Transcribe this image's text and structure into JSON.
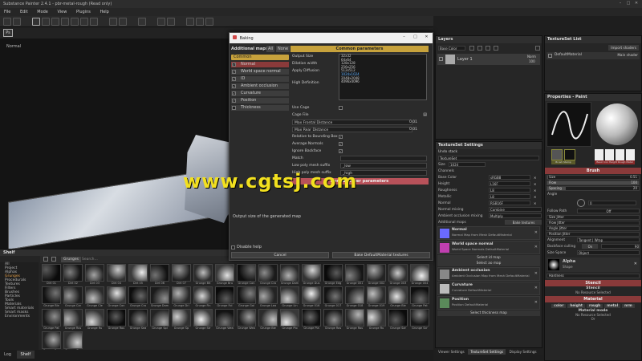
{
  "app": {
    "title": "Substance Painter 2.4.1 - pbr-metal-rough (Read only)"
  },
  "menu": [
    "File",
    "Edit",
    "Mode",
    "View",
    "Plugins",
    "Help"
  ],
  "viewport": {
    "label": "Normal"
  },
  "watermark": "www.cgtsj.com",
  "baking": {
    "title": "Baking",
    "additional_maps_label": "Additional maps",
    "all_label": "All",
    "none_label": "None",
    "common_label": "Common",
    "maps": [
      {
        "label": "Normal",
        "checked": true,
        "active": true
      },
      {
        "label": "World space normal",
        "checked": true
      },
      {
        "label": "ID",
        "checked": true
      },
      {
        "label": "Ambient occlusion",
        "checked": true
      },
      {
        "label": "Curvature",
        "checked": true
      },
      {
        "label": "Position",
        "checked": true
      },
      {
        "label": "Thickness",
        "checked": false
      }
    ],
    "common_params_title": "Common parameters",
    "normal_params_title": "Normal baker parameters",
    "output_size_label": "Output Size",
    "output_size_value": "1024x1024",
    "size_options": [
      "32x32",
      "64x64",
      "128x128",
      "256x256",
      "512x512",
      "1024x1024",
      "2048x2048",
      "4096x4096"
    ],
    "dilation_label": "Dilation width",
    "diffusion_label": "Apply Diffusion",
    "high_def_label": "High Definition",
    "use_cage_label": "Use Cage",
    "cage_file_label": "Cage File",
    "max_frontal_label": "Max Frontal Distance",
    "max_frontal_value": "0.01",
    "max_rear_label": "Max Rear Distance",
    "max_rear_value": "0.01",
    "relative_label": "Relative to Bounding Box",
    "average_label": "Average Normals",
    "ignore_label": "Ignore Backface",
    "match_label": "Match",
    "low_poly_label": "Low poly mesh suffix",
    "low_poly_value": "_low",
    "high_poly_label": "High poly mesh suffix",
    "high_poly_value": "_high",
    "description": "Output size of the generated map",
    "disable_help": "Disable help",
    "cancel": "Cancel",
    "bake": "Bake DefaultMaterial textures"
  },
  "shelf": {
    "title": "Shelf",
    "filter": "Grunges",
    "search_placeholder": "Search...",
    "categories": [
      "All",
      "Project",
      "Alphas",
      "Grunges",
      "Procedurals",
      "Textures",
      "Filters",
      "Brushes",
      "Particles",
      "Tools",
      "Materials",
      "Smart materials",
      "Smart masks",
      "Environments"
    ],
    "selected": "Grunges",
    "items": [
      "Dirt 01",
      "Dirt 02",
      "Dirt 03",
      "Dirt 04",
      "Dirt 05",
      "Dirt 06",
      "Dirt 07",
      "Grunge Bit",
      "Grunge Bru",
      "Grunge Con",
      "Grunge Cra",
      "Grunge Dam",
      "Grunge Dus",
      "Grunge Edg",
      "Grunge 001",
      "Grunge 002",
      "Grunge 003",
      "Grunge 004",
      "Grunge Ble",
      "Grunge Car",
      "Grunge Cle",
      "Grunge Con",
      "Grunge Cra",
      "Grunge Dam",
      "Grunge Dri",
      "Grunge Fin",
      "Grunge Fol",
      "Grunge Gal",
      "Grunge Lea",
      "Grunge Lin",
      "Grunge 016",
      "Grunge 017",
      "Grunge 018",
      "Grunge 019",
      "Grunge Ble",
      "Grunge Pat",
      "Grunge Pat",
      "Grunge Rus",
      "Grunge Ru",
      "Grunge Rou",
      "Grunge Sea",
      "Grunge Spl",
      "Grunge Sp",
      "Grunge Str",
      "Grunge Wea",
      "Grunge Wea",
      "Grunge Ble",
      "Grunge Plo",
      "Grunge Pla",
      "Grunge Ros",
      "Grunge Rou",
      "Grunge Ru",
      "Grunge Sar",
      "Grunge Scr",
      "Grunge Spc",
      "Grunge Sto"
    ]
  },
  "bottom_tabs": {
    "log": "Log",
    "shelf": "Shelf"
  },
  "layers": {
    "title": "Layers",
    "channel": "Base Color",
    "layer_name": "Layer 1",
    "blend": "Norm",
    "opacity": "100"
  },
  "textureset_list": {
    "title": "TextureSet List",
    "settings_btn": "Import shaders",
    "material": "DefaultMaterial",
    "shader": "Main shader"
  },
  "ts_settings": {
    "title": "TextureSet Settings",
    "undo": "Undo stack",
    "set_name": "TextureSet",
    "size_label": "Size",
    "size_value": "1024",
    "channels_label": "Channels",
    "channels": [
      {
        "label": "Base Color",
        "format": "sRGB8"
      },
      {
        "label": "Height",
        "format": "L16F"
      },
      {
        "label": "Roughness",
        "format": "L8"
      },
      {
        "label": "Metallic",
        "format": "L8"
      },
      {
        "label": "Normal",
        "format": "RGB16F"
      }
    ],
    "normal_mixing_label": "Normal mixing",
    "normal_mixing_value": "Combine",
    "ao_mixing_label": "Ambient occlusion mixing",
    "ao_mixing_value": "Multiply",
    "additional_maps_label": "Additional maps",
    "bake_btn": "Bake textures",
    "maps": [
      {
        "title": "Normal",
        "desc": "Normal Map from Mesh DefaultMaterial"
      },
      {
        "title": "World space normal",
        "desc": "World Space Normals DefaultMaterial"
      },
      {
        "title": "Ambient occlusion",
        "desc": "Ambient Occlusion Map from Mesh DefaultMaterial"
      },
      {
        "title": "Curvature",
        "desc": "Curvature DefaultMaterial"
      },
      {
        "title": "Position",
        "desc": "Position DefaultMaterial"
      }
    ],
    "select_id": "Select id map",
    "select_ao": "Select ao map",
    "select_thickness": "Select thickness map",
    "tabs": [
      "Viewer Settings",
      "TextureSet Settings",
      "Display Settings"
    ]
  },
  "properties": {
    "title": "Properties - Paint",
    "brush_label": "Brush",
    "size_label": "Size",
    "size_value": "0.51",
    "flow_label": "Flow",
    "flow_value": "100",
    "spacing_label": "Spacing",
    "spacing_value": "20",
    "angle_label": "Angle",
    "angle_value": "0",
    "follow_path": "Follow Path",
    "follow_value": "Off",
    "size_jitter": "Size Jitter",
    "flow_jitter": "Flow Jitter",
    "angle_jitter": "Angle Jitter",
    "position_jitter": "Position Jitter",
    "alignment_label": "Alignment",
    "alignment_value": "Tangent | Wrap",
    "backface_label": "Backface culling",
    "backface_on": "On",
    "backface_value": "90",
    "size_space_label": "Size Space",
    "size_space_value": "Object",
    "alpha_label": "Alpha",
    "alpha_shape": "Shape",
    "hardness_label": "Hardness",
    "stencil_label": "Stencil",
    "stencil_res": "Stencil",
    "no_resource": "No Resource Selected",
    "material_label": "Material",
    "material_channels": [
      "color",
      "height",
      "rough",
      "metal",
      "nrm"
    ],
    "material_mode": "Material mode",
    "material_res": "No Resource Selected",
    "or_label": "Or",
    "brush_thumbs": [
      "Brush",
      "Stamp",
      "Basic",
      "Iron",
      "Height",
      "Rough",
      "Metal"
    ]
  },
  "colors": {
    "accent_gold": "#c7a23c",
    "accent_red": "#b8525a",
    "watermark": "#f2e01f"
  }
}
